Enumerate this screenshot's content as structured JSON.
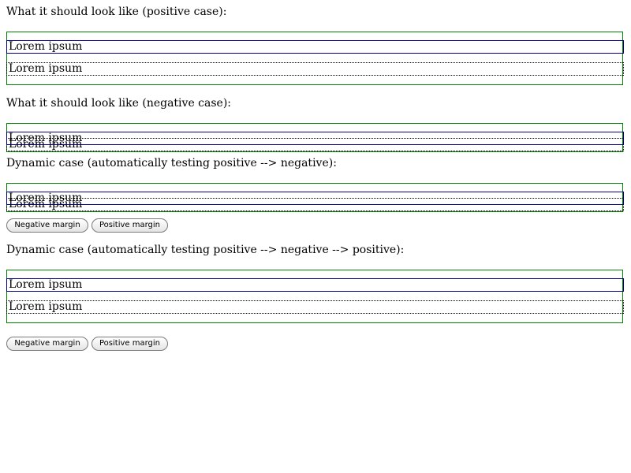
{
  "sections": [
    {
      "heading": "What it should look like (positive case):",
      "lines": [
        "Lorem ipsum",
        "Lorem ipsum"
      ]
    },
    {
      "heading": "What it should look like (negative case):",
      "lines": [
        "Lorem ipsum",
        "Lorem ipsum"
      ]
    },
    {
      "heading": "Dynamic case (automatically testing positive --> negative):",
      "lines": [
        "Lorem ipsum",
        "Lorem ipsum"
      ],
      "buttons": {
        "negative": "Negative margin",
        "positive": "Positive margin"
      }
    },
    {
      "heading": "Dynamic case (automatically testing positive --> negative --> positive):",
      "lines": [
        "Lorem ipsum",
        "Lorem ipsum"
      ],
      "buttons": {
        "negative": "Negative margin",
        "positive": "Positive margin"
      }
    }
  ],
  "colors": {
    "container_border": "#008000",
    "solid_line_border": "#000080",
    "dotted_line_border": "#000000"
  }
}
